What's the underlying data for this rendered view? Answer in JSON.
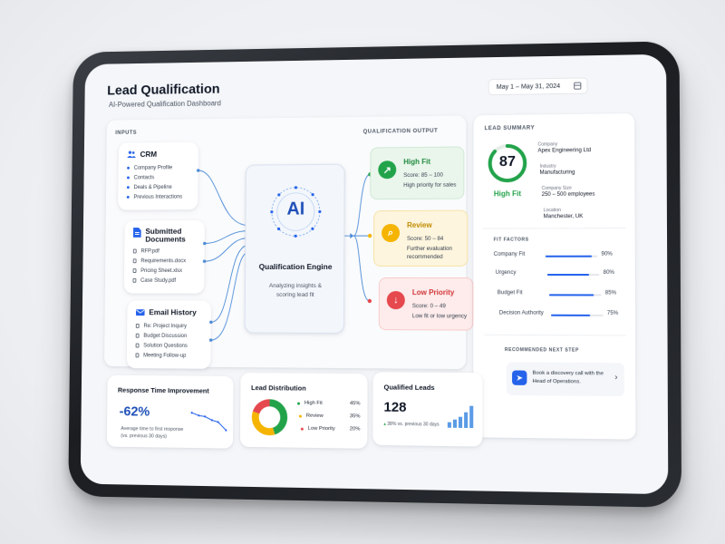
{
  "header": {
    "title": "Lead Qualification",
    "subtitle": "AI-Powered Qualification Dashboard",
    "date_range": "May 1 – May 31, 2024"
  },
  "inputs": {
    "label": "INPUTS",
    "crm": {
      "title": "CRM",
      "items": [
        "Company Profile",
        "Contacts",
        "Deals & Pipeline",
        "Previous Interactions"
      ]
    },
    "documents": {
      "title_line1": "Submitted",
      "title_line2": "Documents",
      "items": [
        "RFP.pdf",
        "Requirements.docx",
        "Pricing Sheet.xlsx",
        "Case Study.pdf"
      ]
    },
    "email": {
      "title": "Email History",
      "items": [
        "Re: Project Inquiry",
        "Budget Discussion",
        "Solution Questions",
        "Meeting Follow-up"
      ]
    }
  },
  "engine": {
    "logo": "AI",
    "title": "Qualification Engine",
    "desc_line1": "Analyzing insights &",
    "desc_line2": "scoring lead fit"
  },
  "output": {
    "label": "QUALIFICATION OUTPUT",
    "high": {
      "title": "High Fit",
      "score": "Score: 85 – 100",
      "desc": "High priority for sales",
      "color": "#22a34a"
    },
    "review": {
      "title": "Review",
      "score": "Score: 50 – 84",
      "desc": "Further evaluation recommended",
      "color": "#f5b400"
    },
    "low": {
      "title": "Low Priority",
      "score": "Score: 0 – 49",
      "desc": "Low fit or low urgency",
      "color": "#e5484d"
    }
  },
  "summary": {
    "label": "LEAD SUMMARY",
    "score": "87",
    "score_fraction": 0.87,
    "fit_label": "High Fit",
    "company_k": "Company",
    "company_v": "Apex Engineering Ltd",
    "industry_k": "Industry",
    "industry_v": "Manufacturing",
    "size_k": "Company Size",
    "size_v": "250 – 500 employees",
    "location_k": "Location",
    "location_v": "Manchester, UK",
    "factors_label": "FIT FACTORS",
    "factors": [
      {
        "name": "Company Fit",
        "value": "90%",
        "fraction": 0.9
      },
      {
        "name": "Urgency",
        "value": "80%",
        "fraction": 0.8
      },
      {
        "name": "Budget Fit",
        "value": "85%",
        "fraction": 0.85
      },
      {
        "name": "Decision Authority",
        "value": "75%",
        "fraction": 0.75
      }
    ],
    "next_step_label": "RECOMMENDED NEXT STEP",
    "next_step_line1": "Book a discovery call with the",
    "next_step_line2": "Head of Operations."
  },
  "response_time": {
    "title": "Response Time Improvement",
    "value": "-62%",
    "desc_line1": "Average time to first response",
    "desc_line2": "(vs. previous 30 days)"
  },
  "distribution": {
    "title": "Lead Distribution",
    "items": [
      {
        "name": "High Fit",
        "value": "45%",
        "fraction": 0.45,
        "color": "#22a34a"
      },
      {
        "name": "Review",
        "value": "35%",
        "fraction": 0.35,
        "color": "#f5b400"
      },
      {
        "name": "Low Priority",
        "value": "20%",
        "fraction": 0.2,
        "color": "#e5484d"
      }
    ]
  },
  "qualified": {
    "title": "Qualified Leads",
    "value": "128",
    "trend": "38% vs. previous 30 days"
  },
  "colors": {
    "accent": "#2563eb",
    "line": "#4a8ad6"
  }
}
